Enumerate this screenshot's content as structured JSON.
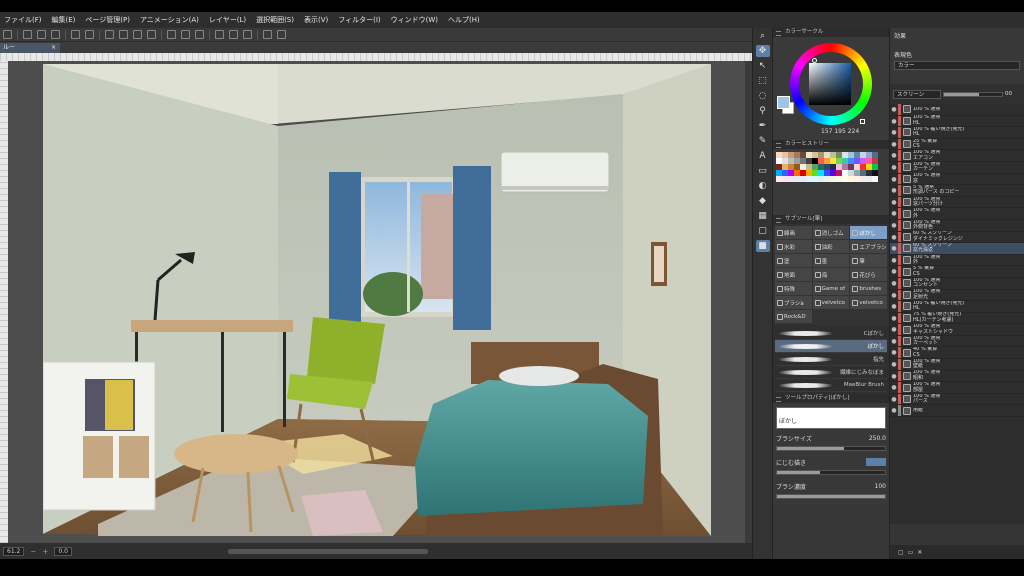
{
  "menu": [
    "ファイル(F)",
    "編集(E)",
    "ページ管理(P)",
    "アニメーション(A)",
    "レイヤー(L)",
    "選択範囲(S)",
    "表示(V)",
    "フィルター(I)",
    "ウィンドウ(W)",
    "ヘルプ(H)"
  ],
  "document_tab": {
    "label": "ルー",
    "close": "×"
  },
  "status": {
    "zoom": "61.2",
    "angle": "0.0"
  },
  "color_wheel": {
    "title": "カラーサークル",
    "rgb_readout": "157  195  224",
    "current_color": "#9ec4e6"
  },
  "color_history": {
    "title": "カラーヒストリー"
  },
  "subtool": {
    "title": "サブツール[筆]",
    "items": [
      "線画",
      "消しゴム",
      "ぼかし",
      "水彩",
      "油彩",
      "エアブラシ",
      "塗",
      "墨",
      "筆",
      "地面",
      "海",
      "花びら",
      "特殊",
      "Game of",
      "brushes",
      "ブラシà",
      "velvetco",
      "velvetco",
      "Rock&D"
    ],
    "active": "ぼかし"
  },
  "brushes": [
    "Cぼかし",
    "ぼかし",
    "指先",
    "繊維にじみなぼま",
    "MaeBlur Brush"
  ],
  "active_brush": "ぼかし",
  "tool_property": {
    "title": "ツールプロパティ[ぼかし]",
    "preview_label": "ぼかし",
    "brush_size_label": "ブラシサイズ",
    "brush_size": "250.0",
    "blend_label": "にじむ描き",
    "density_label": "ブラシ濃度",
    "density": "100"
  },
  "layer_panel": {
    "effect_label": "効果",
    "display_color_label": "表現色",
    "display_color_value": "カラー",
    "blend_mode": "スクリーン",
    "opacity": "00"
  },
  "layers": [
    {
      "line1": "100 % 通常",
      "line2": "",
      "color": "#c95a5a",
      "sel": false
    },
    {
      "line1": "100 % 通常",
      "line2": "HL",
      "color": "#c95a5a",
      "sel": false
    },
    {
      "line1": "100 % 覆い焼き(発光)",
      "line2": "HL",
      "color": "#c95a5a",
      "sel": false
    },
    {
      "line1": "25 % 乗算",
      "line2": "CS",
      "color": "#c95a5a",
      "sel": false
    },
    {
      "line1": "100 % 通常",
      "line2": "エアコン",
      "color": "#c95a5a",
      "sel": false
    },
    {
      "line1": "100 % 通常",
      "line2": "カーテン",
      "color": "#c95a5a",
      "sel": false
    },
    {
      "line1": "100 % 通常",
      "line2": "窓",
      "color": "#c95a5a",
      "sel": false
    },
    {
      "line1": "5 % 通常",
      "line2": "形調パース のコピー",
      "color": "#c95a5a",
      "sel": false
    },
    {
      "line1": "100 % 通常",
      "line2": "窓パーツ分け",
      "color": "#c95a5a",
      "sel": false
    },
    {
      "line1": "100 % 通常",
      "line2": "外",
      "color": "#c95a5a",
      "sel": false
    },
    {
      "line1": "100 % 通常",
      "line2": "外側背色",
      "color": "#c95a5a",
      "sel": false
    },
    {
      "line1": "60 % スクリーン",
      "line2": "ダイナミックレジンジ",
      "color": "#c95a5a",
      "sel": false
    },
    {
      "line1": "60 % スクリーン",
      "line2": "窓光漏返",
      "color": "#c95a5a",
      "sel": true
    },
    {
      "line1": "100 % 通常",
      "line2": "外",
      "color": "#c95a5a",
      "sel": false
    },
    {
      "line1": "5 % 乗算",
      "line2": "CS",
      "color": "#c95a5a",
      "sel": false
    },
    {
      "line1": "100 % 通常",
      "line2": "コンセント",
      "color": "#c95a5a",
      "sel": false
    },
    {
      "line1": "100 % 通常",
      "line2": "足射光",
      "color": "#c95a5a",
      "sel": false
    },
    {
      "line1": "100 % 覆い焼き(発光)",
      "line2": "HL",
      "color": "#c95a5a",
      "sel": false
    },
    {
      "line1": "75 % 覆い焼き(発光)",
      "line2": "HL(カーテン考慮)",
      "color": "#c95a5a",
      "sel": false
    },
    {
      "line1": "100 % 通常",
      "line2": "キャストシャドウ",
      "color": "#c95a5a",
      "sel": false
    },
    {
      "line1": "100 % 通常",
      "line2": "カーペット",
      "color": "#c95a5a",
      "sel": false
    },
    {
      "line1": "40 % 乗算",
      "line2": "CS",
      "color": "#c95a5a",
      "sel": false
    },
    {
      "line1": "100 % 通常",
      "line2": "壁紙",
      "color": "#c95a5a",
      "sel": false
    },
    {
      "line1": "100 % 通常",
      "line2": "昭和",
      "color": "#c95a5a",
      "sel": false
    },
    {
      "line1": "100 % 通常",
      "line2": "部屋",
      "color": "#c95a5a",
      "sel": false
    },
    {
      "line1": "100 % 通常",
      "line2": "パース",
      "color": "#c95a5a",
      "sel": false
    },
    {
      "line1": "",
      "line2": "用紙",
      "color": "#888888",
      "sel": false
    }
  ]
}
